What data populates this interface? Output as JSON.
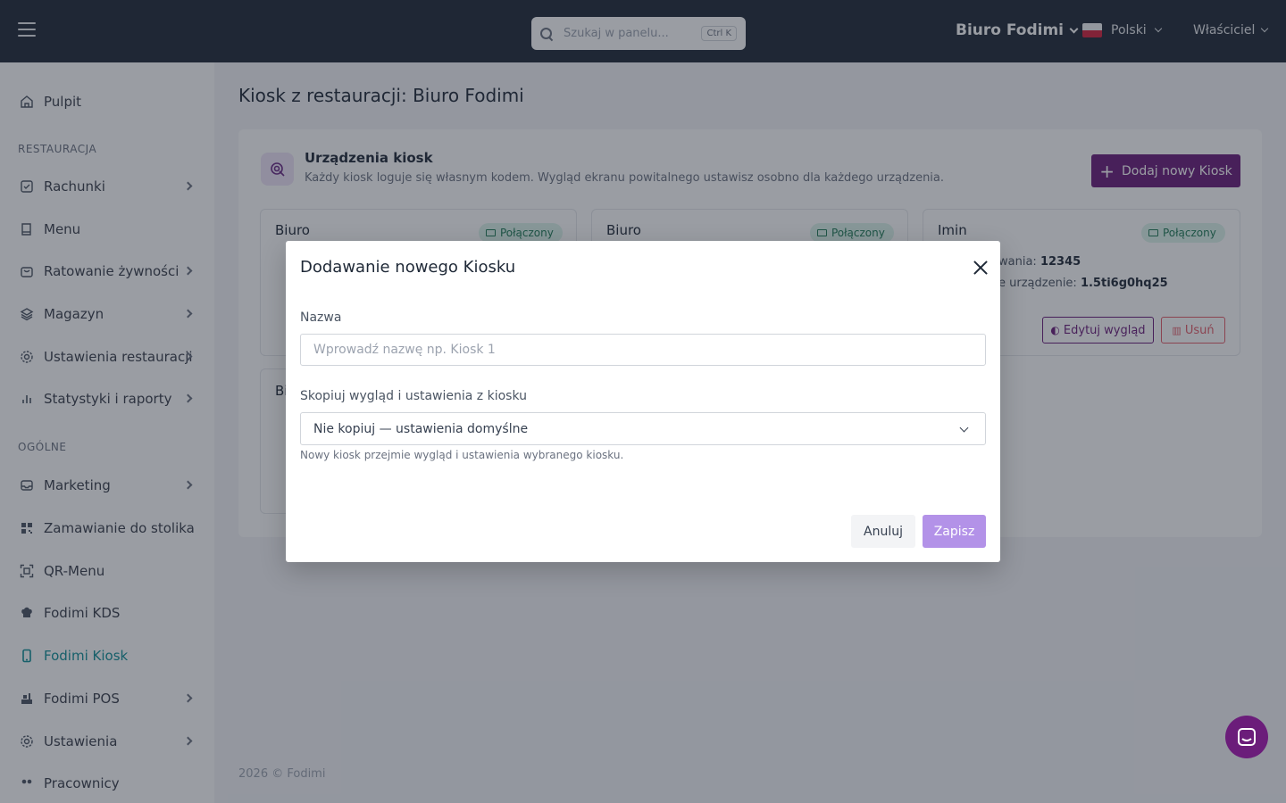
{
  "topbar": {
    "search_placeholder": "Szukaj w panelu...",
    "search_shortcut": "Ctrl K",
    "organization": "Biuro Fodimi",
    "language": "Polski",
    "user_role": "Właściciel"
  },
  "sidebar": {
    "sections": {
      "restaurant": "RESTAURACJA",
      "general": "OGÓLNE"
    },
    "items": [
      {
        "label": "Pulpit",
        "icon": "home-icon"
      },
      {
        "label": "Rachunki",
        "icon": "receipt-icon"
      },
      {
        "label": "Menu",
        "icon": "book-icon"
      },
      {
        "label": "Ratowanie żywności",
        "icon": "bag-icon"
      },
      {
        "label": "Magazyn",
        "icon": "layers-icon"
      },
      {
        "label": "Ustawienia restauracji",
        "icon": "gear-icon"
      },
      {
        "label": "Statystyki i raporty",
        "icon": "bar-chart-icon"
      },
      {
        "label": "Marketing",
        "icon": "inbox-icon"
      },
      {
        "label": "Zamawianie do stolika",
        "icon": "qr-grid-icon"
      },
      {
        "label": "QR-Menu",
        "icon": "qr-scan-icon"
      },
      {
        "label": "Fodimi KDS",
        "icon": "chef-hat-icon"
      },
      {
        "label": "Fodimi Kiosk",
        "icon": "tablet-icon"
      },
      {
        "label": "Fodimi POS",
        "icon": "register-icon"
      },
      {
        "label": "Ustawienia",
        "icon": "gear-icon"
      },
      {
        "label": "Pracownicy",
        "icon": "users-icon"
      }
    ]
  },
  "main": {
    "title": "Kiosk z restauracji: Biuro Fodimi",
    "panel": {
      "title": "Urządzenia kiosk",
      "subtitle": "Każdy kiosk loguje się własnym kodem. Wygląd ekranu powitalnego ustawisz osobno dla każdego urządzenia.",
      "add_button": "Dodaj nowy Kiosk"
    },
    "cards": [
      {
        "name": "Biuro",
        "status": "Połączony"
      },
      {
        "name": "Biuro",
        "status": "Połączony"
      },
      {
        "name": "Imin",
        "status": "Połączony",
        "code_label_partial": "wania:",
        "code_value": "12345",
        "device_label_partial": "e urządzenie:",
        "device_value": "1.5ti6g0hq25",
        "edit_button": "Edytuj wygląd",
        "delete_button": "Usuń"
      },
      {
        "name_partial": "Bi"
      }
    ],
    "footer": "2026 © Fodimi"
  },
  "modal": {
    "title": "Dodawanie nowego Kiosku",
    "name_label": "Nazwa",
    "name_placeholder": "Wprowadź nazwę np. Kiosk 1",
    "name_value": "",
    "copy_label": "Skopiuj wygląd i ustawienia z kiosku",
    "copy_selected": "Nie kopiuj — ustawienia domyślne",
    "copy_hint": "Nowy kiosk przejmie wygląd i ustawienia wybranego kiosku.",
    "cancel": "Anuluj",
    "save": "Zapisz"
  },
  "colors": {
    "topbar_bg": "#1f2937",
    "brand_purple": "#6b1d7a",
    "active_teal": "#0f8f97",
    "save_disabled": "#b392e8",
    "status_green_bg": "#dcf5ec",
    "danger": "#e35d6a"
  }
}
